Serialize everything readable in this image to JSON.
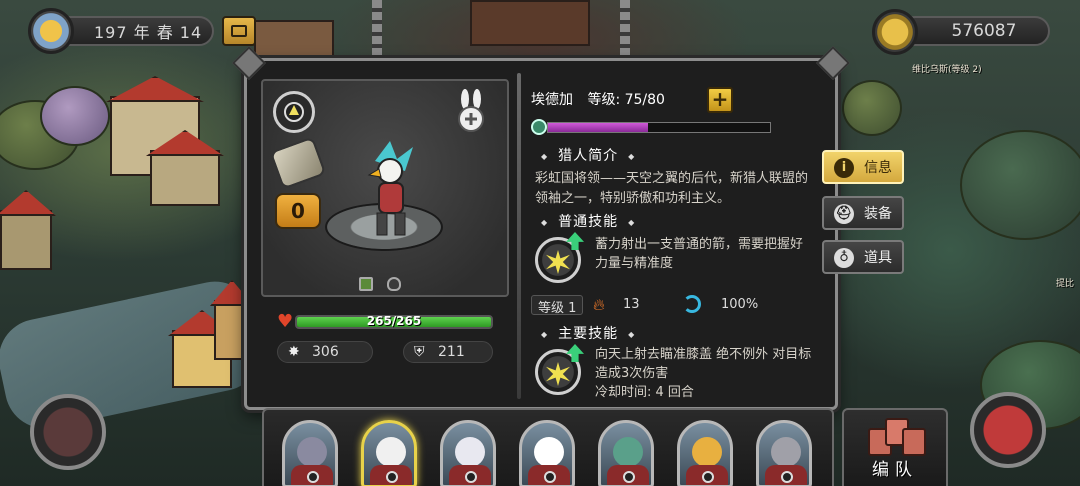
{
  "top_bar": {
    "date_text": "197 年 春 14",
    "gold_amount": "576087"
  },
  "map_labels": {
    "npc_label": "维比乌斯(等级 2)",
    "edge_label": "提比"
  },
  "hero": {
    "name": "埃德加",
    "level_text": "等级: 75/80",
    "level_up_icon": "plus-icon",
    "xp_progress_percent": 45,
    "rank_number": "0",
    "hp_text": "265/265",
    "hp_percent": 100,
    "attack": "306",
    "defense": "211"
  },
  "bio": {
    "title": "猎人简介",
    "text": "彩虹国将领——天空之翼的后代，新猎人联盟的领袖之一，特别骄傲和功利主义。"
  },
  "normal_skill": {
    "title": "普通技能",
    "description": "蓄力射出一支普通的箭，需要把握好力量与精准度",
    "level_label": "等级 1",
    "flame_value": "13",
    "accuracy_value": "100%"
  },
  "main_skill": {
    "title": "主要技能",
    "description": "向天上射去瞄准膝盖 绝不例外 对目标造成3次伤害",
    "cooldown": "冷却时间: 4 回合"
  },
  "side_tabs": [
    {
      "label": "信息",
      "icon": "info-icon",
      "active": true
    },
    {
      "label": "装备",
      "icon": "helmet-icon",
      "active": false
    },
    {
      "label": "道具",
      "icon": "potion-icon",
      "active": false
    }
  ],
  "roster": [
    {
      "name": "hero-1",
      "face_color": "#8a8aa0",
      "selected": false
    },
    {
      "name": "hero-2",
      "face_color": "#f0f0f0",
      "selected": true
    },
    {
      "name": "hero-3",
      "face_color": "#e8e8f0",
      "selected": false
    },
    {
      "name": "hero-4",
      "face_color": "#ffffff",
      "selected": false
    },
    {
      "name": "hero-5",
      "face_color": "#5aa08a",
      "selected": false
    },
    {
      "name": "hero-6",
      "face_color": "#e8b040",
      "selected": false
    },
    {
      "name": "hero-7",
      "face_color": "#a0a0a8",
      "selected": false
    }
  ],
  "team_button": {
    "label": "编队"
  },
  "colors": {
    "accent_gold": "#e8c04a",
    "hp_green": "#4ec040",
    "xp_purple": "#c04ac8"
  }
}
